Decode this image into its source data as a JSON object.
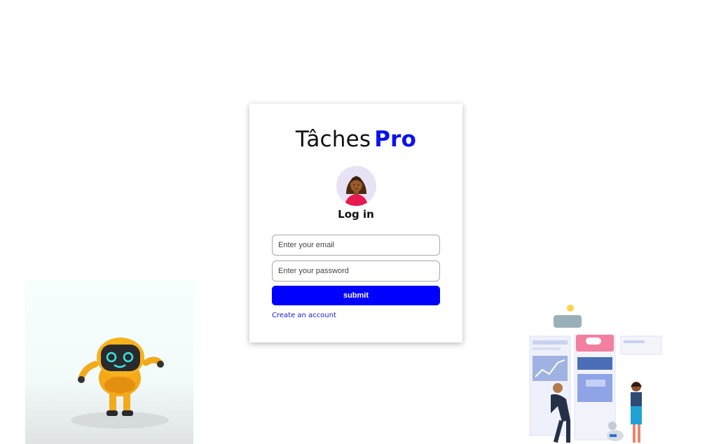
{
  "brand": {
    "name": "Tâches",
    "accent": "Pro",
    "accent_color": "#0a12ee"
  },
  "login": {
    "title": "Log in",
    "email_placeholder": "Enter your email",
    "password_placeholder": "Enter your password",
    "submit_label": "submit",
    "create_account_label": "Create an account",
    "submit_color": "#0000ff"
  },
  "icons": {
    "avatar": "user-avatar-woman-icon",
    "robot": "robot-illustration",
    "team": "team-workspace-illustration"
  }
}
